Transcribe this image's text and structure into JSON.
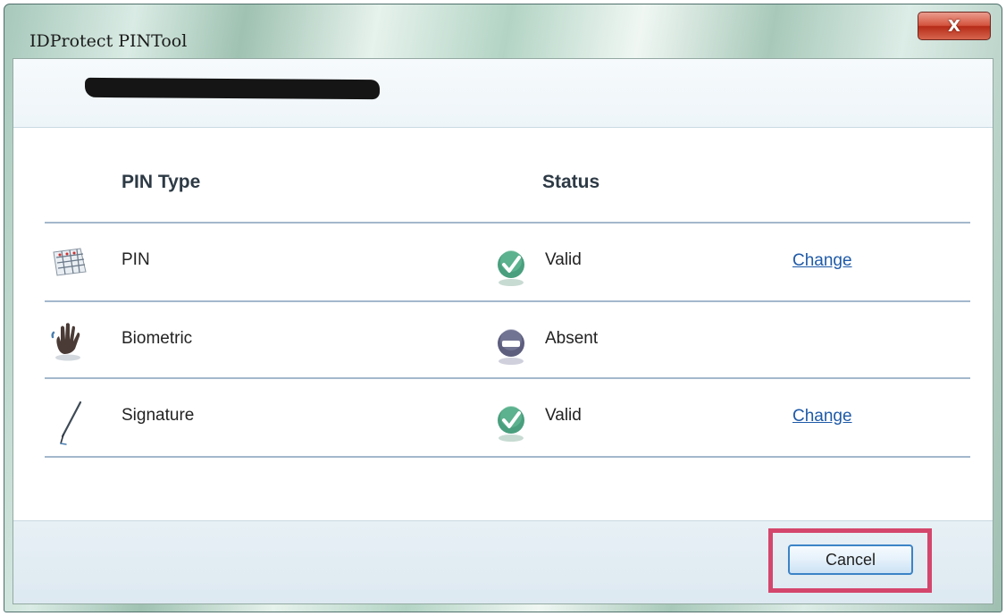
{
  "window": {
    "title": "IDProtect PINTool",
    "close_glyph": "X"
  },
  "table": {
    "headers": {
      "pin_type": "PIN Type",
      "status": "Status"
    },
    "rows": [
      {
        "label": "PIN",
        "icon": "pin-keypad-icon",
        "status": "Valid",
        "status_icon": "check-valid-icon",
        "action": "Change"
      },
      {
        "label": "Biometric",
        "icon": "hand-biometric-icon",
        "status": "Absent",
        "status_icon": "minus-absent-icon",
        "action": ""
      },
      {
        "label": "Signature",
        "icon": "pen-signature-icon",
        "status": "Valid",
        "status_icon": "check-valid-icon",
        "action": "Change"
      }
    ]
  },
  "footer": {
    "cancel_label": "Cancel"
  },
  "colors": {
    "valid": "#4a9f7e",
    "absent": "#5d5e7e",
    "link": "#1f5aa8",
    "highlight": "#d4466c"
  }
}
